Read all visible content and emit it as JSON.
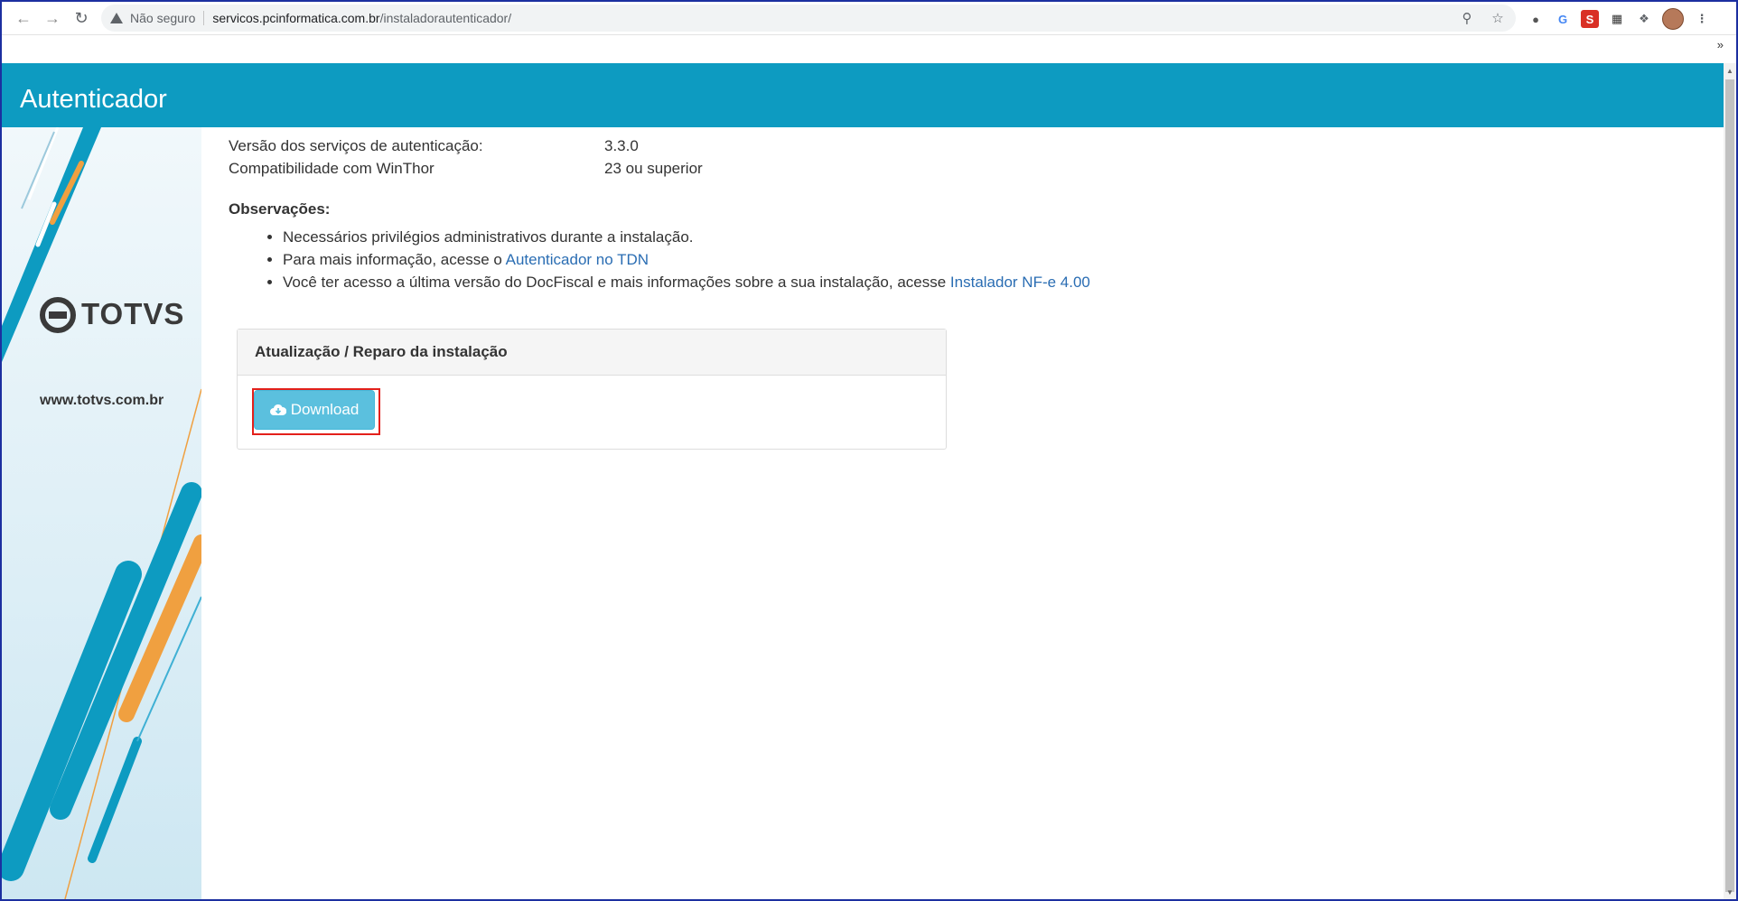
{
  "browser": {
    "security_label": "Não seguro",
    "url_host": "servicos.pcinformatica.com.br",
    "url_path": "/instaladorautenticador/",
    "bookmarks_more": "»"
  },
  "header": {
    "title": "Autenticador"
  },
  "sidebar": {
    "logo_text": "TOTVS",
    "site_url": "www.totvs.com.br"
  },
  "info": {
    "rows": [
      {
        "label": "Versão dos serviços de autenticação:",
        "value": "3.3.0"
      },
      {
        "label": "Compatibilidade com WinThor",
        "value": "23 ou superior"
      }
    ]
  },
  "observations": {
    "title": "Observações:",
    "items": [
      {
        "text": "Necessários privilégios administrativos durante a instalação.",
        "link": ""
      },
      {
        "text": "Para mais informação, acesse o ",
        "link": "Autenticador no TDN"
      },
      {
        "text": "Você ter acesso a última versão do DocFiscal e mais informações sobre a sua instalação, acesse ",
        "link": "Instalador NF-e 4.00"
      }
    ]
  },
  "panel": {
    "heading": "Atualização / Reparo da instalação",
    "download_label": "Download"
  },
  "colors": {
    "header_bg": "#0d9bc1",
    "button_bg": "#5bc0de",
    "link": "#2a6db3",
    "highlight": "#e3201b",
    "accent_orange": "#f0a040"
  }
}
